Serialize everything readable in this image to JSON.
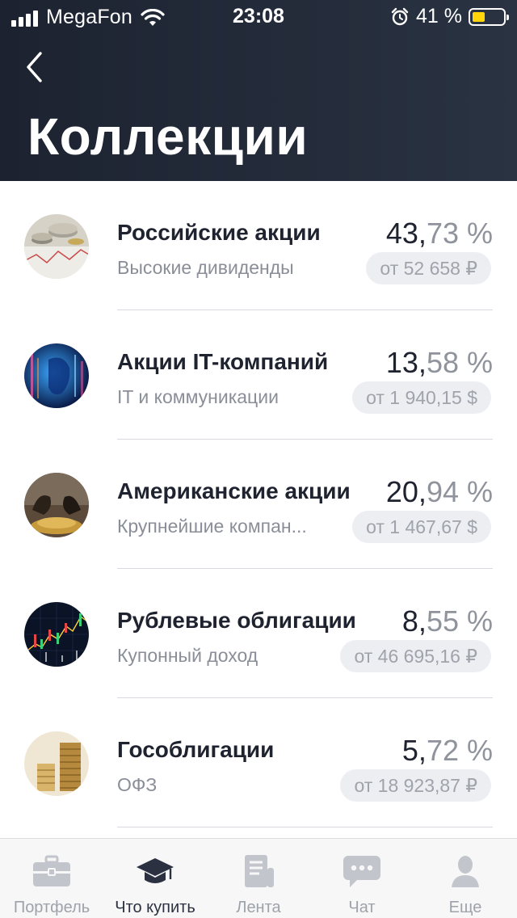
{
  "status": {
    "carrier": "MegaFon",
    "time": "23:08",
    "battery": "41 %"
  },
  "header": {
    "title": "Коллекции"
  },
  "collections": [
    {
      "name": "Российские акции",
      "subtitle": "Высокие дивиденды",
      "pct_int": "43,",
      "pct_dec": "73 %",
      "price": "от 52 658 ₽"
    },
    {
      "name": "Акции IT-компаний",
      "subtitle": "IT и коммуникации",
      "pct_int": "13,",
      "pct_dec": "58 %",
      "price": "от 1 940,15 $"
    },
    {
      "name": "Американские акции",
      "subtitle": "Крупнейшие компан...",
      "pct_int": "20,",
      "pct_dec": "94 %",
      "price": "от 1 467,67 $"
    },
    {
      "name": "Рублевые облигации",
      "subtitle": "Купонный доход",
      "pct_int": "8,",
      "pct_dec": "55 %",
      "price": "от 46 695,16 ₽"
    },
    {
      "name": "Гособлигации",
      "subtitle": "ОФЗ",
      "pct_int": "5,",
      "pct_dec": "72 %",
      "price": "от 18 923,87 ₽"
    }
  ],
  "tabbar": {
    "tabs": [
      {
        "label": "Портфель",
        "icon": "briefcase-icon",
        "active": false
      },
      {
        "label": "Что купить",
        "icon": "graduation-cap-icon",
        "active": true
      },
      {
        "label": "Лента",
        "icon": "news-icon",
        "active": false
      },
      {
        "label": "Чат",
        "icon": "chat-icon",
        "active": false
      },
      {
        "label": "Еще",
        "icon": "profile-icon",
        "active": false
      }
    ]
  },
  "colors": {
    "header_bg": "#1c2230",
    "text_primary": "#1f2330",
    "text_secondary": "#8a8e98",
    "battery_fill": "#ffd60a",
    "tab_inactive": "#c2c5cb",
    "tab_active": "#2b3140"
  }
}
